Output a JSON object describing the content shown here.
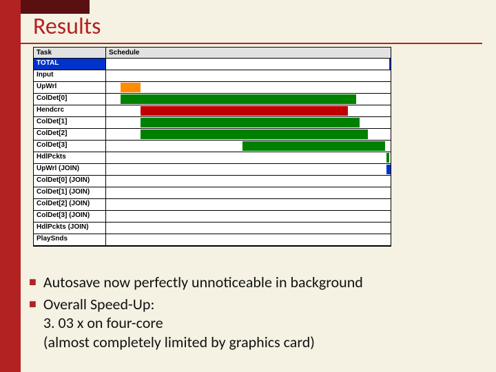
{
  "title": "Results",
  "bullets": {
    "b1": "Autosave now perfectly unnoticeable in background",
    "b2": "Overall Speed-Up:",
    "b2_sub1": "3. 03 x on four-core",
    "b2_sub2": "(almost completely limited by graphics card)"
  },
  "chart_data": {
    "type": "bar",
    "title": "",
    "xlabel": "Schedule",
    "ylabel": "Task",
    "headers": {
      "task": "Task",
      "schedule": "Schedule"
    },
    "rows": [
      {
        "label": "TOTAL",
        "total_marker_pct": 100
      },
      {
        "label": "Input",
        "bars": []
      },
      {
        "label": "UpWrl",
        "bars": [
          {
            "start_pct": 5,
            "end_pct": 12,
            "color": "orange"
          }
        ]
      },
      {
        "label": "ColDet[0]",
        "bars": [
          {
            "start_pct": 5,
            "end_pct": 88,
            "color": "green"
          }
        ]
      },
      {
        "label": "Hendcrc",
        "bars": [
          {
            "start_pct": 12,
            "end_pct": 85,
            "color": "red"
          }
        ]
      },
      {
        "label": "ColDet[1]",
        "bars": [
          {
            "start_pct": 12,
            "end_pct": 89,
            "color": "green"
          }
        ]
      },
      {
        "label": "ColDet[2]",
        "bars": [
          {
            "start_pct": 12,
            "end_pct": 92,
            "color": "green"
          }
        ]
      },
      {
        "label": "ColDet[3]",
        "bars": [
          {
            "start_pct": 48,
            "end_pct": 98,
            "color": "green"
          }
        ]
      },
      {
        "label": "HdlPckts",
        "bars": [
          {
            "start_pct": 98.5,
            "end_pct": 99.5,
            "color": "green"
          }
        ]
      },
      {
        "label": "UpWrl (JOIN)",
        "bars": [
          {
            "start_pct": 98.5,
            "end_pct": 100,
            "color": "blue"
          }
        ]
      },
      {
        "label": "ColDet[0] (JOIN)",
        "bars": []
      },
      {
        "label": "ColDet[1] (JOIN)",
        "bars": []
      },
      {
        "label": "ColDet[2] (JOIN)",
        "bars": []
      },
      {
        "label": "ColDet[3] (JOIN)",
        "bars": []
      },
      {
        "label": "HdlPckts (JOIN)",
        "bars": []
      },
      {
        "label": "PlaySnds",
        "bars": []
      }
    ]
  }
}
